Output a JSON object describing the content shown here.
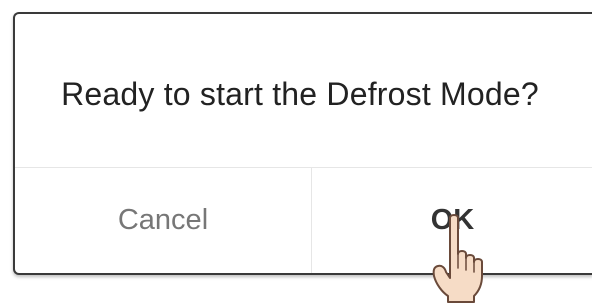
{
  "dialog": {
    "message": "Ready to start the Defrost Mode?",
    "cancel_label": "Cancel",
    "ok_label": "OK"
  },
  "cursor": {
    "icon": "pointing-hand-icon"
  }
}
